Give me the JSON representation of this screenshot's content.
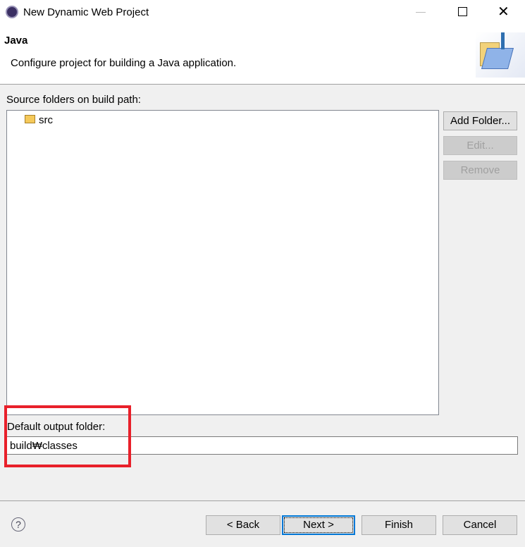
{
  "window": {
    "title": "New Dynamic Web Project",
    "minimize_icon": "minimize-icon",
    "maximize_icon": "maximize-icon",
    "close_icon": "close-icon"
  },
  "header": {
    "title": "Java",
    "description": "Configure project for building a Java application.",
    "banner_icon": "java-folder-icon"
  },
  "source": {
    "label": "Source folders on build path:",
    "items": [
      {
        "label": "src",
        "icon": "package-folder-icon"
      }
    ]
  },
  "side_buttons": {
    "add_folder": "Add Folder...",
    "edit": "Edit...",
    "remove": "Remove"
  },
  "output": {
    "label": "Default output folder:",
    "value": "build₩classes"
  },
  "highlight_color": "#e8202a",
  "footer": {
    "help_icon": "help-icon",
    "back": "< Back",
    "next": "Next >",
    "finish": "Finish",
    "cancel": "Cancel"
  }
}
